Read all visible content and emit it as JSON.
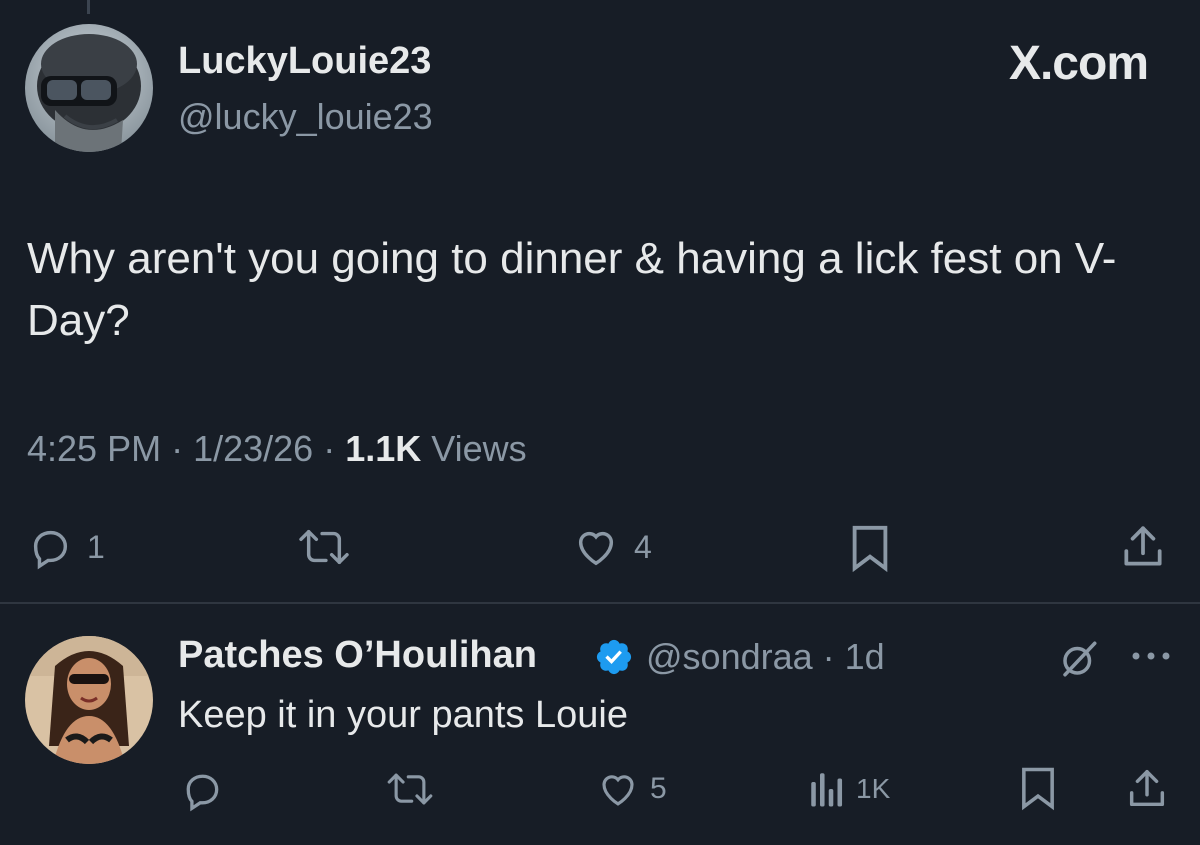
{
  "main_tweet": {
    "display_name": "LuckyLouie23",
    "handle": "@lucky_louie23",
    "brand": "X.com",
    "text": "Why aren't you going to dinner & having a lick fest on V-Day?",
    "time": "4:25 PM",
    "date": "1/23/26",
    "views_count": "1.1K",
    "views_label": "Views",
    "reply_count": "1",
    "like_count": "4"
  },
  "reply": {
    "display_name": "Patches O’Houlihan",
    "handle": "@sondraa",
    "age": "1d",
    "text": "Keep it in your pants Louie",
    "like_count": "5",
    "views_count": "1K"
  },
  "colors": {
    "background": "#171d26",
    "text": "#e7e9ea",
    "muted": "#8b98a5",
    "verified": "#1d9bf0"
  },
  "icons": [
    "reply-icon",
    "retweet-icon",
    "like-icon",
    "bookmark-icon",
    "share-icon",
    "views-icon",
    "verified-badge-icon",
    "grok-icon",
    "more-icon"
  ]
}
